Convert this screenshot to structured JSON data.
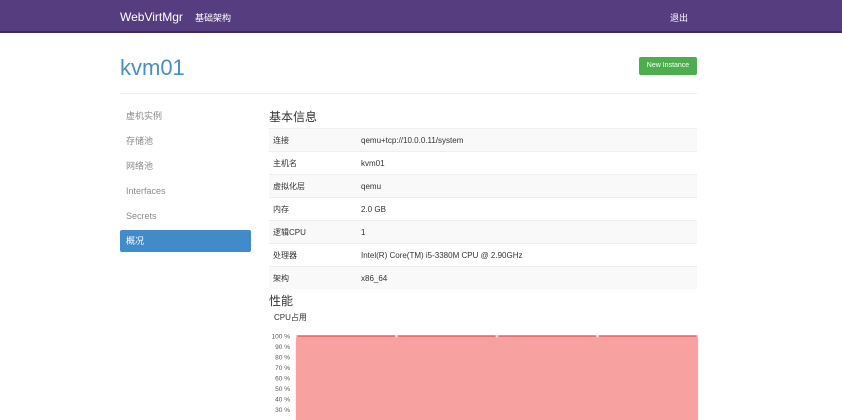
{
  "navbar": {
    "brand": "WebVirtMgr",
    "link_hosts": "基础架构",
    "logout": "退出"
  },
  "page": {
    "title": "kvm01",
    "new_instance_label": "New Instance"
  },
  "sidebar": {
    "items": [
      {
        "label": "虚机实例",
        "active": false
      },
      {
        "label": "存储池",
        "active": false
      },
      {
        "label": "网络池",
        "active": false
      },
      {
        "label": "Interfaces",
        "active": false
      },
      {
        "label": "Secrets",
        "active": false
      },
      {
        "label": "概况",
        "active": true
      }
    ]
  },
  "info": {
    "title": "基本信息",
    "rows": [
      {
        "key": "连接",
        "value": "qemu+tcp://10.0.0.11/system"
      },
      {
        "key": "主机名",
        "value": "kvm01"
      },
      {
        "key": "虚拟化层",
        "value": "qemu"
      },
      {
        "key": "内存",
        "value": "2.0 GB"
      },
      {
        "key": "逻辑CPU",
        "value": "1"
      },
      {
        "key": "处理器",
        "value": "Intel(R) Core(TM) i5-3380M CPU @ 2.90GHz"
      },
      {
        "key": "架构",
        "value": "x86_64"
      }
    ]
  },
  "performance": {
    "title": "性能",
    "cpu_label": "CPU占用"
  },
  "chart_data": {
    "type": "area",
    "title": "",
    "y_ticks": [
      "100 %",
      "90 %",
      "80 %",
      "70 %",
      "60 %",
      "50 %",
      "40 %",
      "30 %"
    ],
    "ylim": [
      30,
      100
    ],
    "x": [
      0,
      1,
      2,
      3,
      4
    ],
    "series": [
      {
        "values": [
          100,
          100,
          100,
          100,
          100
        ],
        "color": "#f7a1a1",
        "line_color": "#e06464"
      }
    ],
    "grid": true
  }
}
